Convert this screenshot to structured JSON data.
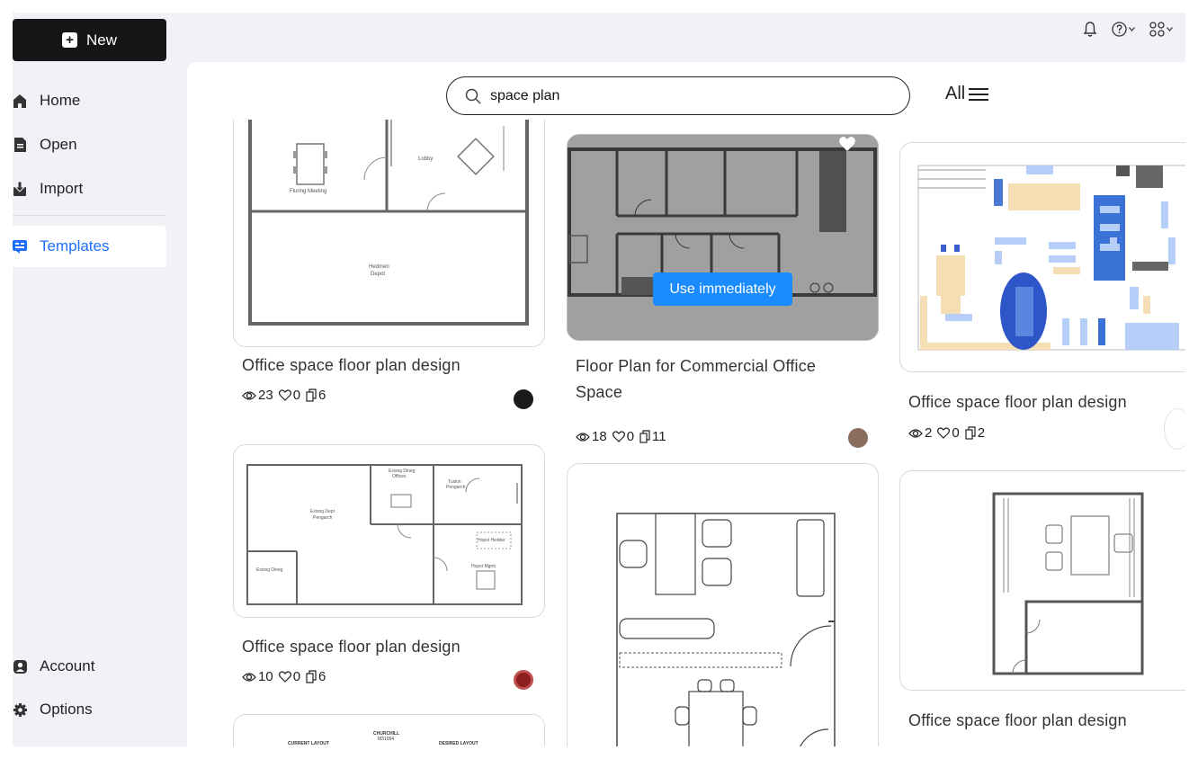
{
  "sidebar": {
    "new_label": "New",
    "items": [
      {
        "label": "Home",
        "icon": "home-icon"
      },
      {
        "label": "Open",
        "icon": "document-icon"
      },
      {
        "label": "Import",
        "icon": "import-icon"
      },
      {
        "label": "Templates",
        "icon": "templates-icon",
        "active": true
      }
    ],
    "bottom_items": [
      {
        "label": "Account",
        "icon": "account-icon"
      },
      {
        "label": "Options",
        "icon": "gear-icon"
      }
    ]
  },
  "search": {
    "value": "space plan",
    "filter_label": "All"
  },
  "cards": [
    {
      "title": "Office space floor plan design",
      "views": "23",
      "likes": "0",
      "copies": "6"
    },
    {
      "title": "Floor Plan for Commercial Office Space",
      "views": "18",
      "likes": "0",
      "copies": "11",
      "hover_button": "Use immediately"
    },
    {
      "title": "Office space floor plan design",
      "views": "2",
      "likes": "0",
      "copies": "2"
    },
    {
      "title": "Office space floor plan design",
      "views": "10",
      "likes": "0",
      "copies": "6"
    },
    {
      "title": "Office space floor plan design"
    }
  ],
  "plan_labels": {
    "p1_room1": "Fluring Meeting",
    "p1_room2": "Lobby",
    "p1_room3": "Hedmen",
    "p1_room3b": "Depot",
    "p4_room1": "Exisng Dept",
    "p4_room1b": "Pengarch",
    "p4_room2": "Exisng Dineg",
    "p4_room2b": "Offices",
    "p4_room3": "Exisng Dineg",
    "p4_room4": "Tuskin",
    "p4_room4b": "Pengarch",
    "p4_room5": "Hopst Hedder",
    "p4_room6": "Hopst Mgmt",
    "p6_title": "CHURCHILL",
    "p6_sub": "M31054",
    "p6_left": "CURRENT LAYOUT",
    "p6_right": "DESIRED LAYOUT"
  },
  "colors": {
    "accent": "#1e6fff",
    "use_button": "#1a8cff",
    "new_button": "#161616"
  }
}
